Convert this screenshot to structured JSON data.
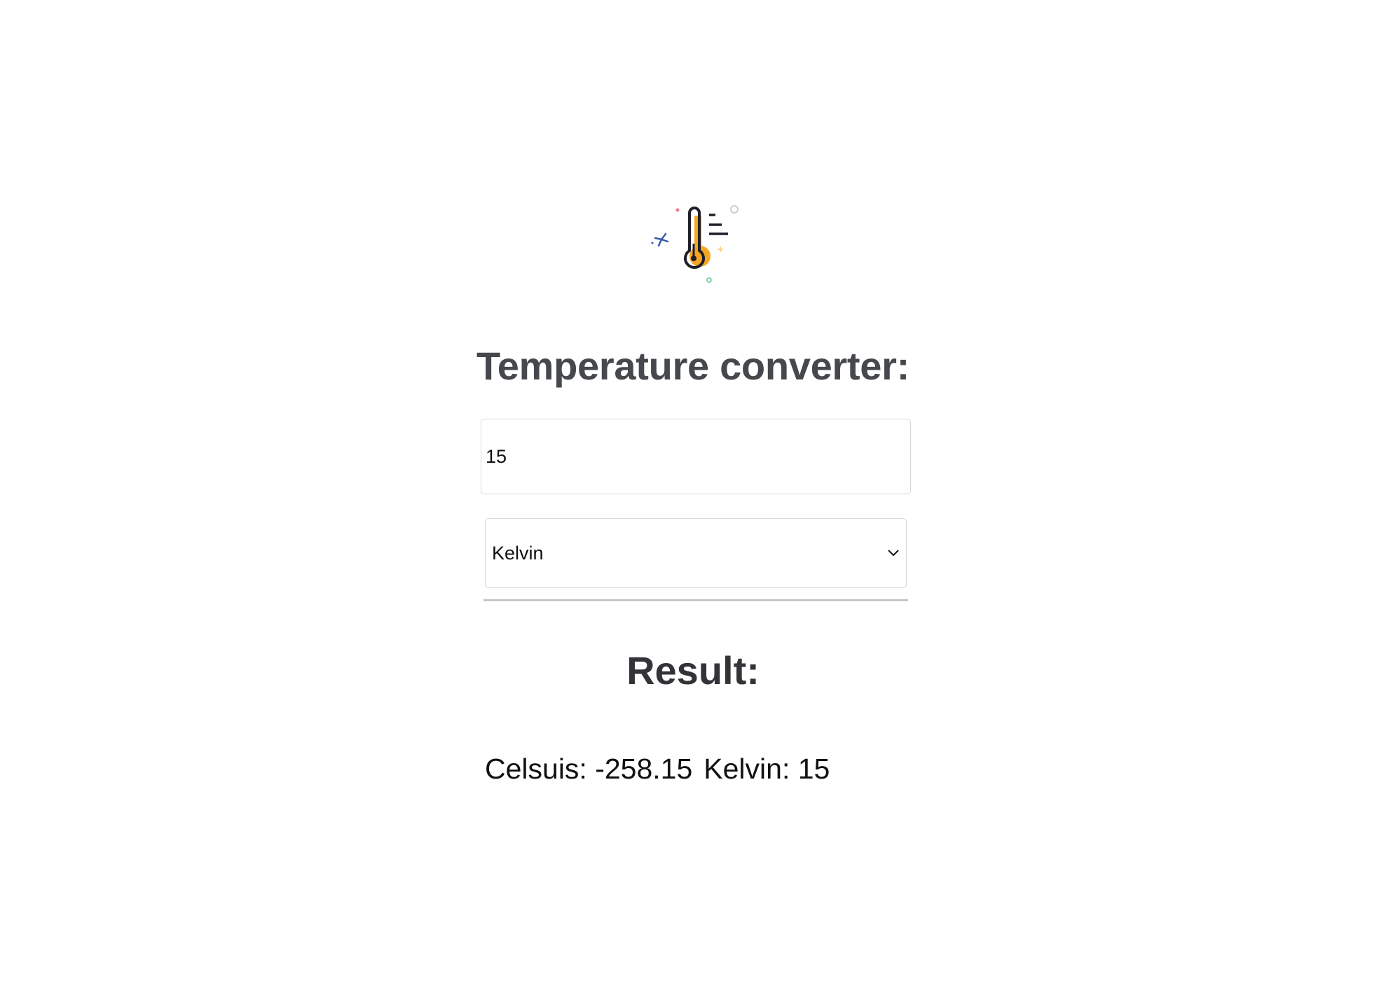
{
  "app": {
    "title": "Temperature converter:"
  },
  "icons": {
    "logo": "thermometer-icon",
    "select_arrow": "chevron-down-icon"
  },
  "input": {
    "value": "15"
  },
  "unit_select": {
    "selected": "Kelvin"
  },
  "result": {
    "title": "Result:",
    "celsius": "Celsuis: -258.15",
    "kelvin": "Kelvin: 15"
  },
  "colors": {
    "accent": "#f5a623",
    "text": "#45484d"
  }
}
